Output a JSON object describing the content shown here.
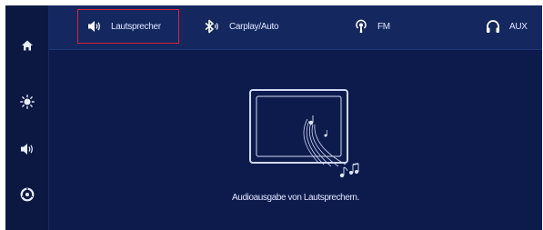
{
  "sidebar": {
    "items": [
      {
        "icon": "home-icon"
      },
      {
        "icon": "brightness-icon"
      },
      {
        "icon": "speaker-icon"
      },
      {
        "icon": "settings-icon"
      }
    ]
  },
  "tabs": [
    {
      "label": "Lautsprecher",
      "icon": "speaker-icon",
      "active": true
    },
    {
      "label": "Carplay/Auto",
      "icon": "bluetooth-icon",
      "active": false
    },
    {
      "label": "FM",
      "icon": "radio-antenna-icon",
      "active": false
    },
    {
      "label": "AUX",
      "icon": "headphones-icon",
      "active": false
    }
  ],
  "main": {
    "caption": "Audioausgabe von Lautsprechern."
  },
  "colors": {
    "background": "#0d1b4c",
    "topbar": "#14275f",
    "active_border": "#e0203a",
    "text": "#dfe6ff"
  }
}
